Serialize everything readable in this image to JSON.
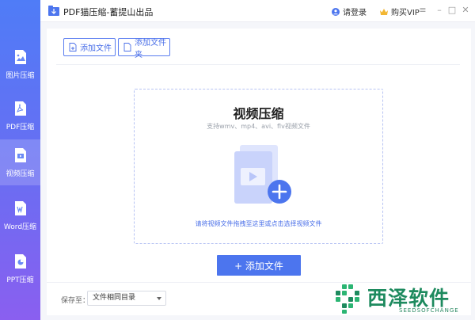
{
  "window": {
    "title": "PDF猫压缩-蓄提山出品",
    "login": "请登录",
    "vip": "购买VIP"
  },
  "sidebar": {
    "items": [
      {
        "label": "图片压缩",
        "icon": "image-file-icon"
      },
      {
        "label": "PDF压缩",
        "icon": "pdf-file-icon"
      },
      {
        "label": "视频压缩",
        "icon": "video-file-icon",
        "active": true
      },
      {
        "label": "Word压缩",
        "icon": "word-file-icon"
      },
      {
        "label": "PPT压缩",
        "icon": "ppt-file-icon"
      }
    ]
  },
  "toolbar": {
    "add_file": "添加文件",
    "add_folder": "添加文件夹"
  },
  "dropzone": {
    "title": "视频压缩",
    "subtitle": "支持wmv、mp4、avi、flv视频文件",
    "hint": "请将视频文件拖拽至这里或点击选择视频文件"
  },
  "add_button": "+ 添加文件",
  "save": {
    "label": "保存至：",
    "value": "文件相同目录"
  },
  "watermark": {
    "text": "西泽软件",
    "sub": "SEEDSOFCHANGE"
  },
  "colors": {
    "accent": "#4c75ee",
    "sidebar_top": "#4f7cf7",
    "sidebar_bottom": "#8a5ff0",
    "watermark": "#1d8a5e"
  }
}
